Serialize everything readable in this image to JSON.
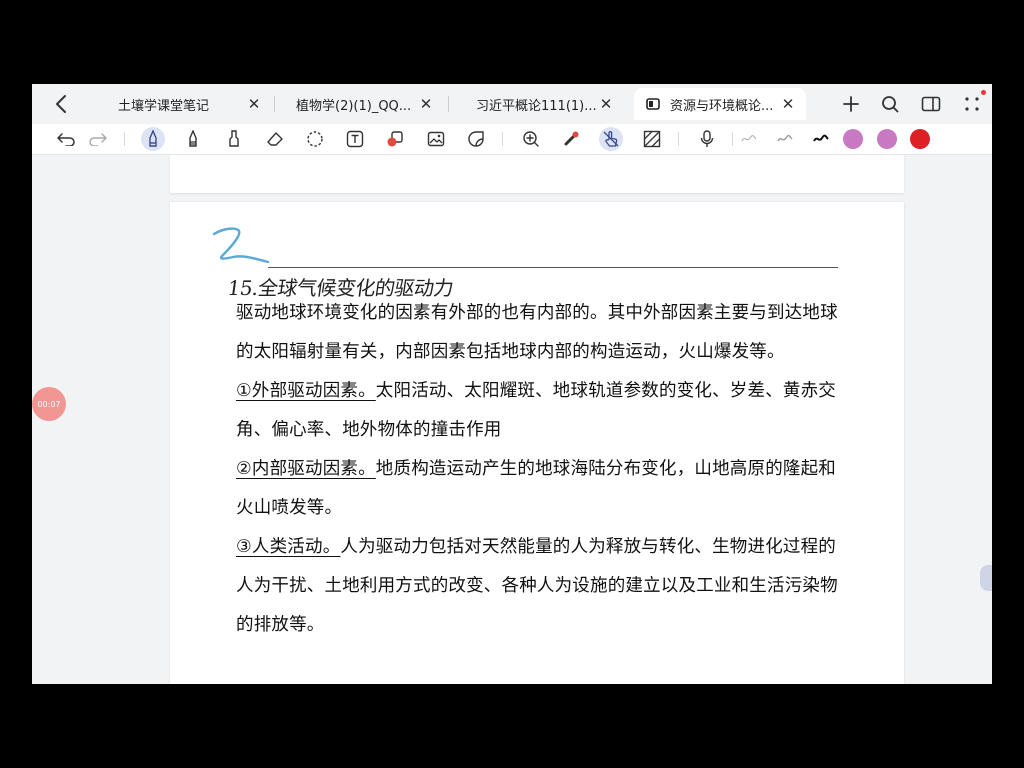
{
  "tabs": [
    {
      "title": "土壤学课堂笔记",
      "active": false
    },
    {
      "title": "植物学(2)(1)_QQ...",
      "active": false
    },
    {
      "title": "习近平概论111(1)...",
      "active": false
    },
    {
      "title": "资源与环境概论...",
      "active": true
    }
  ],
  "icons": {
    "back": "chevron-left-icon",
    "close": "close-icon",
    "add": "plus-icon",
    "search": "search-icon",
    "layout": "sidebar-layout-icon",
    "more": "grid-dots-icon"
  },
  "toolbar": {
    "tools": [
      "undo-icon",
      "redo-icon",
      "pen-icon",
      "fountain-pen-icon",
      "highlighter-icon",
      "eraser-icon",
      "lasso-icon",
      "text-box-icon",
      "shapes-icon",
      "image-icon",
      "sticker-icon",
      "zoom-in-icon",
      "laser-pointer-icon",
      "hand-touch-icon",
      "pattern-icon",
      "microphone-icon",
      "stroke-thin-icon",
      "stroke-medium-icon",
      "stroke-thick-icon"
    ],
    "colors": [
      "#c879c2",
      "#c879c2",
      "#dd1f26"
    ]
  },
  "timer": {
    "label": "00:07"
  },
  "note": {
    "hand_number": "2",
    "hand_title": "15.全球气候变化的驱动力",
    "intro": "驱动地球环境变化的因素有外部的也有内部的。其中外部因素主要与到达地球的太阳辐射量有关，内部因素包括地球内部的构造运动，火山爆发等。",
    "points": [
      {
        "label": "①外部驱动因素。",
        "text": "太阳活动、太阳耀斑、地球轨道参数的变化、岁差、黄赤交角、偏心率、地外物体的撞击作用"
      },
      {
        "label": "②内部驱动因素。",
        "text": "地质构造运动产生的地球海陆分布变化，山地高原的隆起和火山喷发等。"
      },
      {
        "label": "③人类活动。",
        "text": "人为驱动力包括对天然能量的人为释放与转化、生物进化过程的人为干扰、土地利用方式的改变、各种人为设施的建立以及工业和生活污染物的排放等。"
      }
    ]
  }
}
